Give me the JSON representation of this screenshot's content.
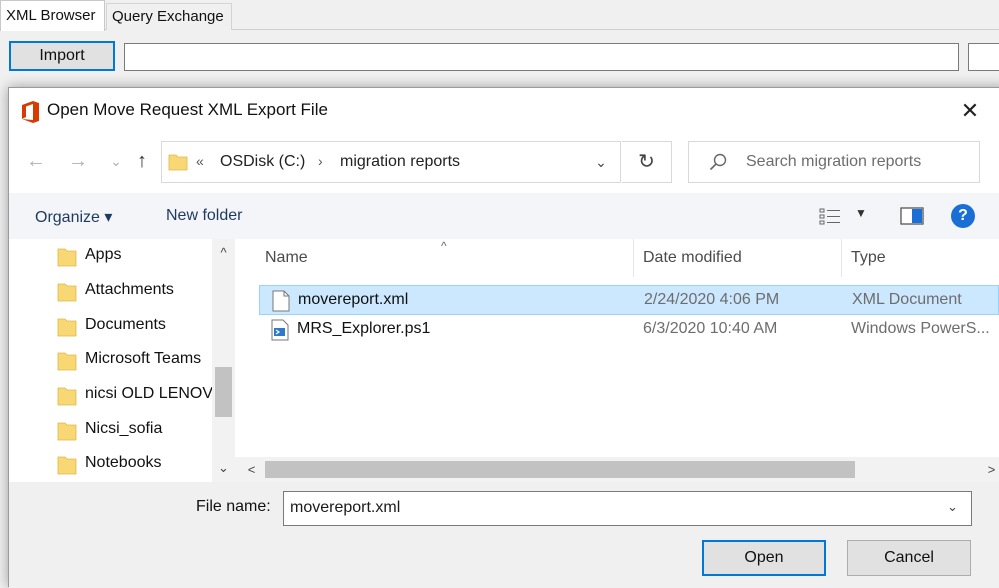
{
  "app": {
    "tabs": [
      {
        "label": "XML Browser",
        "active": true
      },
      {
        "label": "Query Exchange",
        "active": false
      }
    ],
    "import_label": "Import"
  },
  "dialog": {
    "title": "Open Move Request XML Export File",
    "close_glyph": "✕",
    "nav": {
      "back_glyph": "←",
      "forward_glyph": "→",
      "recent_glyph": "⌄",
      "up_glyph": "↑"
    },
    "address": {
      "overflow": "«",
      "segments": [
        "OSDisk (C:)",
        "migration reports"
      ],
      "separator": "›",
      "dropdown_glyph": "⌄"
    },
    "refresh_glyph": "↻",
    "search": {
      "placeholder": "Search migration reports"
    },
    "commands": {
      "organize": "Organize ▾",
      "new_folder": "New folder",
      "view_dropdown": "▼",
      "help": "?"
    },
    "tree": {
      "items": [
        "Apps",
        "Attachments",
        "Documents",
        "Microsoft Teams",
        "nicsi OLD LENOV",
        "Nicsi_sofia",
        "Notebooks"
      ],
      "scroll_up": "^",
      "scroll_down": "⌄"
    },
    "list": {
      "columns": {
        "name": "Name",
        "date": "Date modified",
        "type": "Type"
      },
      "sort_glyph": "^",
      "files": [
        {
          "name": "movereport.xml",
          "date": "2/24/2020 4:06 PM",
          "type": "XML Document",
          "icon": "xml-file-icon",
          "selected": true
        },
        {
          "name": "MRS_Explorer.ps1",
          "date": "6/3/2020 10:40 AM",
          "type": "Windows PowerS...",
          "icon": "powershell-file-icon",
          "selected": false
        }
      ],
      "scroll_left": "<",
      "scroll_right": ">"
    },
    "footer": {
      "file_name_label": "File name:",
      "file_name_value": "movereport.xml",
      "dropdown_glyph": "⌄",
      "open_label": "Open",
      "cancel_label": "Cancel"
    }
  }
}
